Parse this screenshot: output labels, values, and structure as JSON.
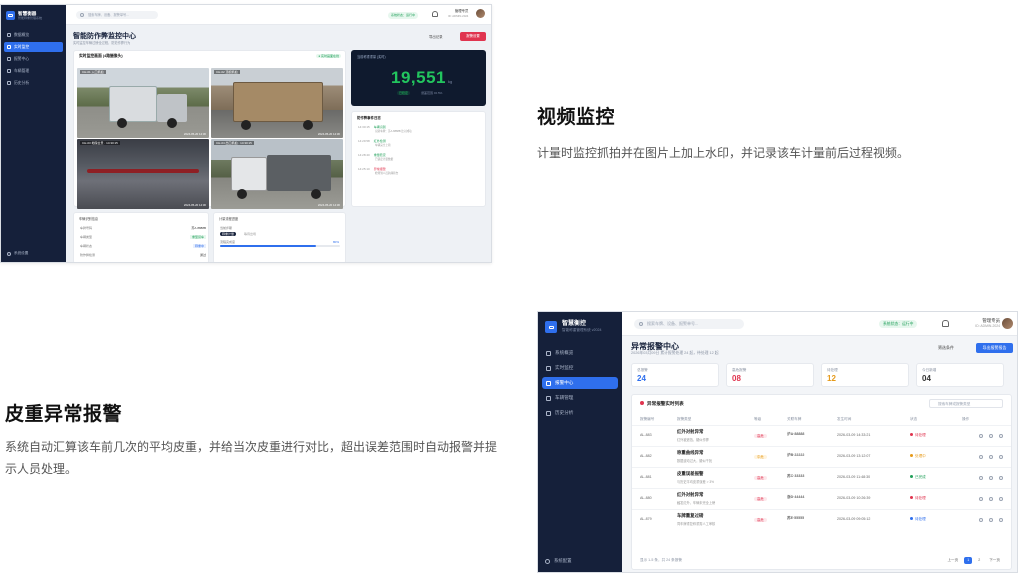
{
  "section_video": {
    "heading": "视频监控",
    "description": "计量时监控抓拍并在图片上加上水印，并记录该车计量前后过程视频。"
  },
  "section_alarm": {
    "heading": "皮重异常报警",
    "description": "系统自动汇算该车前几次的平均皮重，并给当次皮重进行对比，超出误差范围时自动报警并提示人员处理。"
  },
  "screen1": {
    "brand": {
      "name": "智慧衡器",
      "sub": "智能称重管理系统"
    },
    "nav": [
      "数据概览",
      "实时监控",
      "报警中心",
      "车辆管理",
      "历史分析"
    ],
    "nav_active": 1,
    "footer": "系统设置",
    "search_placeholder": "搜索车牌、设备、报警单号...",
    "status": "系统状态：运行中",
    "user_name": "管理专员",
    "user_role": "ID: ADMIN-2024",
    "title": "智能防作弊监控中心",
    "subtitle": "实时监控车辆过磅全过程，防范作弊行为",
    "actions": {
      "export": "导出记录",
      "alarm": "报警设置"
    },
    "video_panel": {
      "title": "实时监控画面 (4路摄像头)",
      "tag": "● 实时画面在线",
      "cameras": [
        {
          "label": "CH-01 入口抓拍",
          "watermark": "2024-05-20 14:30"
        },
        {
          "label": "CH-02 顶视抓拍",
          "watermark": "2024-05-20 14:30"
        },
        {
          "label": "CH-03 地磅全景 · 14:30:15",
          "watermark": "2024-05-20 14:30"
        },
        {
          "label": "CH-04 出口抓拍 · 14:30:15",
          "watermark": "2024-05-20 14:30"
        }
      ]
    },
    "weight": {
      "label": "当前称重重量 (实时)",
      "value": "19,551",
      "unit": "kg",
      "chip1": "已稳定",
      "chip2": "误差范围 ±0.5%"
    },
    "log": {
      "title": "防作弊事件日志",
      "items": [
        {
          "time": "14:30:15",
          "event": "车辆识别",
          "desc": "识别车牌：苏A·8888B 比对成功",
          "alert": false
        },
        {
          "time": "14:29:58",
          "event": "红外检测",
          "desc": "车辆完全上磅",
          "alert": false
        },
        {
          "time": "14:28:40",
          "event": "重量稳定",
          "desc": "已锁定计量数据",
          "alert": false
        },
        {
          "time": "14:25:10",
          "event": "异常报警",
          "desc": "检测到人员跨越磅台",
          "alert": true
        }
      ]
    },
    "info_card": {
      "title": "车辆识别信息",
      "rows": [
        {
          "k": "车牌号码",
          "v": "苏A·8888B",
          "style": ""
        },
        {
          "k": "车辆类型",
          "v": "重型货车",
          "style": "g"
        },
        {
          "k": "车辆状态",
          "v": "称重中",
          "style": "b"
        },
        {
          "k": "防作弊检测",
          "v": "通过",
          "style": ""
        }
      ]
    },
    "process_card": {
      "title": "计量流程进度",
      "step": "当前步骤",
      "chip": "称重计量",
      "next": "等待出场",
      "progress_label": "流程完成度",
      "progress_value": "80%",
      "progress": 0.8
    }
  },
  "screen2": {
    "brand": {
      "name": "智慧衡控",
      "sub": "智能称重管理系统 v2024"
    },
    "nav": [
      "系统概览",
      "实时监控",
      "报警中心",
      "车辆管理",
      "历史分析"
    ],
    "nav_active": 2,
    "footer": "系统配置",
    "search_placeholder": "搜索车牌、设备、报警单号...",
    "status": "系统状态：运行中",
    "user_name": "管理专员",
    "user_role": "ID: ADMIN-2024",
    "title": "异常报警中心",
    "subtitle": "2026年03月09日 累计报警处理 24 起，待处理 12 起",
    "filter": "筛选条件",
    "action_button": "导出报警报告",
    "stats": [
      {
        "k": "总报警",
        "v": "24",
        "color": "#2f6fed"
      },
      {
        "k": "高危报警",
        "v": "08",
        "color": "#e0344f"
      },
      {
        "k": "待处理",
        "v": "12",
        "color": "#e69a1a"
      },
      {
        "k": "今日新增",
        "v": "04",
        "color": "#333333"
      }
    ],
    "table": {
      "title": "异常报警实时列表",
      "search_placeholder": "搜索车牌或报警类型",
      "headers": [
        "报警编号",
        "报警类型",
        "等级",
        "关联车牌",
        "发生时间",
        "状态",
        "操作"
      ],
      "rows": [
        {
          "id": "AL-883",
          "type": "红外对射异常",
          "desc": "红外被遮挡，疑似作弊",
          "level": "高危",
          "lvl": "hi",
          "plate": "沪A·88888",
          "time": "2026-03-09 14:33:21",
          "status": "待处理",
          "st": "red"
        },
        {
          "id": "AL-882",
          "type": "称重曲线异常",
          "desc": "数据波动过大，疑似干扰",
          "level": "中危",
          "lvl": "md",
          "plate": "沪B·22222",
          "time": "2026-03-09 13:12:07",
          "status": "处理中",
          "st": "org"
        },
        {
          "id": "AL-881",
          "type": "皮重误差报警",
          "desc": "与历史平均皮重误差 > 3%",
          "level": "高危",
          "lvl": "hi",
          "plate": "苏C·33333",
          "time": "2026-03-09 11:48:30",
          "status": "已完成",
          "st": "grn"
        },
        {
          "id": "AL-880",
          "type": "红外对射异常",
          "desc": "触发红外，车辆未完全上磅",
          "level": "高危",
          "lvl": "hi",
          "plate": "浙D·44444",
          "time": "2026-03-09 10:26:39",
          "status": "待处理",
          "st": "red"
        },
        {
          "id": "AL-879",
          "type": "车牌重复过磅",
          "desc": "同车牌重复称重需人工审核",
          "level": "高危",
          "lvl": "hi",
          "plate": "苏E·55555",
          "time": "2026-03-09 09:05:12",
          "status": "待处理",
          "st": "blu"
        }
      ],
      "pagination_text": "显示 1-5 条，共 24 条报警",
      "prev": "上一页",
      "pages": [
        "1",
        "2"
      ],
      "next": "下一页"
    }
  }
}
